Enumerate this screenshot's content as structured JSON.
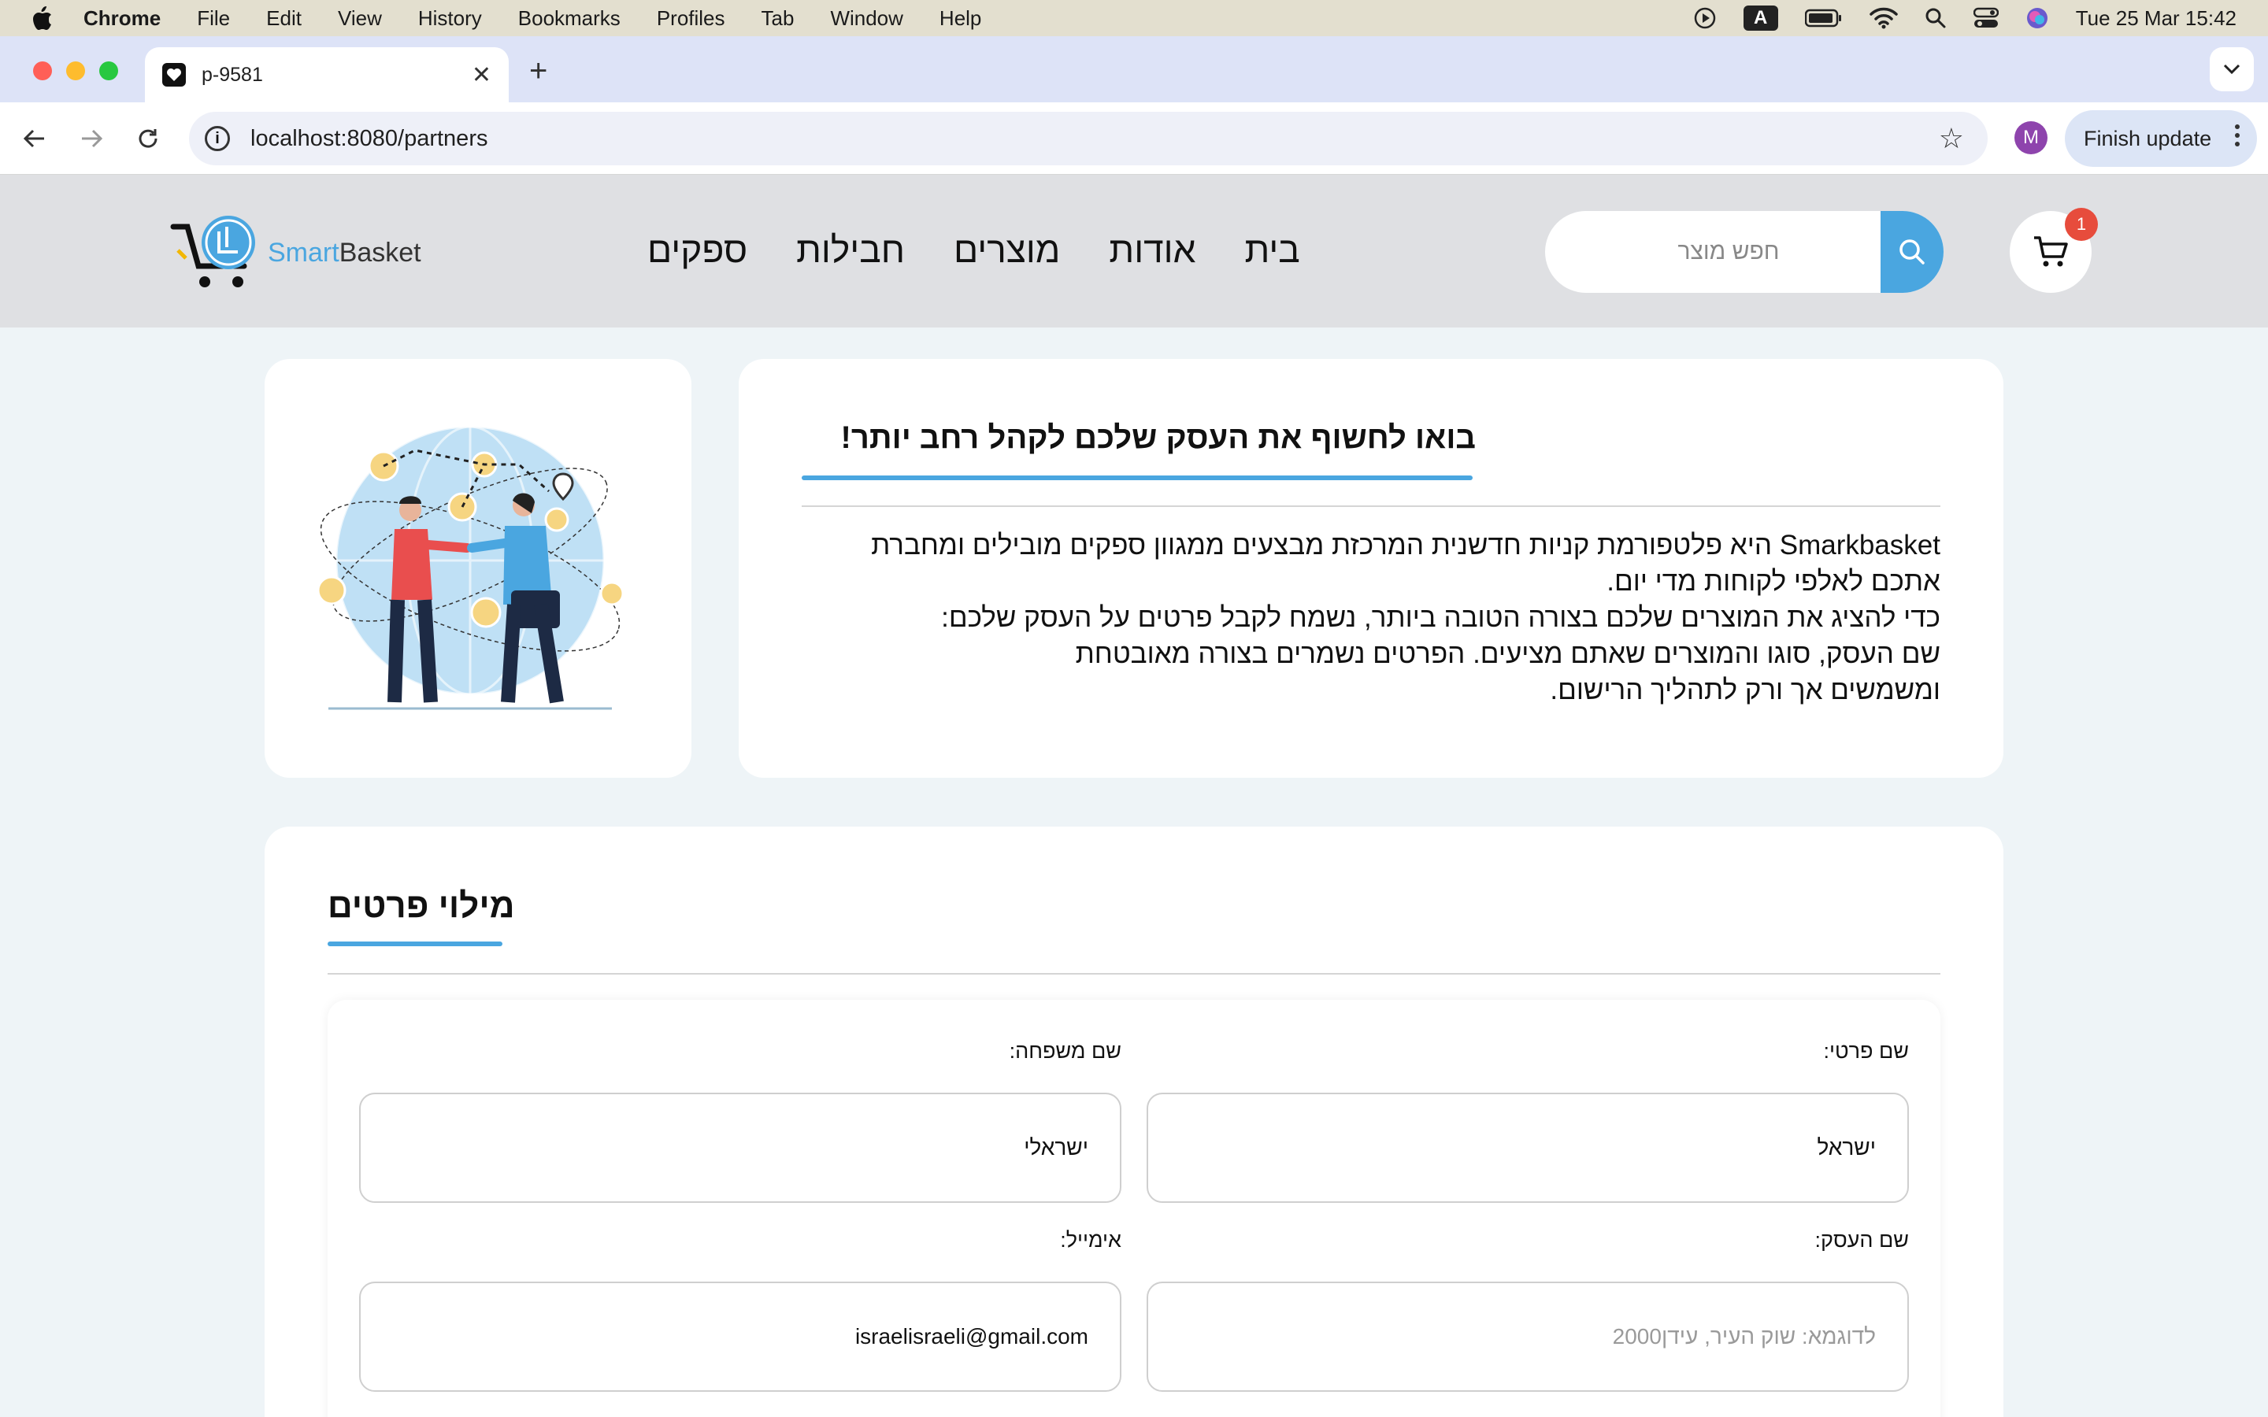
{
  "menubar": {
    "app_name": "Chrome",
    "items": [
      "File",
      "Edit",
      "View",
      "History",
      "Bookmarks",
      "Profiles",
      "Tab",
      "Window",
      "Help"
    ],
    "kbd_label": "A",
    "datetime": "Tue 25 Mar  15:42"
  },
  "browser": {
    "tab_title": "p-9581",
    "url": "localhost:8080/partners",
    "profile_initial": "M",
    "update_label": "Finish update"
  },
  "site": {
    "logo": {
      "smart": "Smart",
      "basket": "Basket"
    },
    "nav": [
      "בית",
      "אודות",
      "מוצרים",
      "חבילות",
      "ספקים"
    ],
    "search_placeholder": "חפש מוצר",
    "cart_count": "1"
  },
  "intro": {
    "headline": "בואו לחשוף את העסק שלכם לקהל רחב יותר!",
    "paragraph1": "Smarkbasket היא פלטפורמת קניות חדשנית המרכזת מבצעים ממגוון ספקים מובילים ומחברת אתכם לאלפי לקוחות מדי יום.",
    "paragraph2": "כדי להציג את המוצרים שלכם בצורה הטובה ביותר, נשמח לקבל פרטים על העסק שלכם:\nשם העסק, סוגו והמוצרים שאתם מציעים. הפרטים נשמרים בצורה מאובטחת\nומשמשים אך ורק לתהליך הרישום."
  },
  "form": {
    "title": "מילוי פרטים",
    "first_name_label": "שם פרטי:",
    "first_name_value": "ישראל",
    "last_name_label": "שם משפחה:",
    "last_name_value": "ישראלי",
    "business_label": "שם העסק:",
    "business_placeholder": "לדוגמא: שוק העיר, עידן2000",
    "email_label": "אימייל:",
    "email_value": "israelisraeli@gmail.com"
  },
  "colors": {
    "accent": "#4aa6e0",
    "badge": "#e74c3c",
    "header_bg": "#dfe0e3",
    "page_bg": "#eef4f7"
  }
}
